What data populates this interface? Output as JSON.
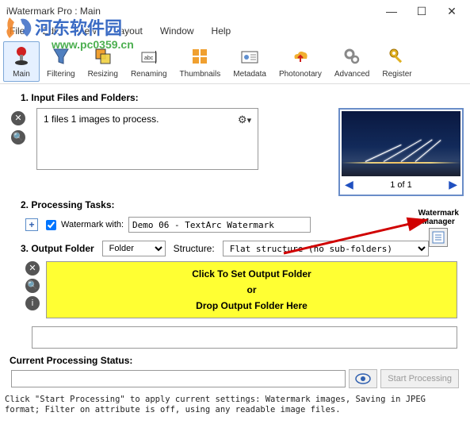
{
  "titlebar": {
    "title": "iWatermark Pro : Main"
  },
  "watermark": {
    "cn": "河东软件园",
    "url": "www.pc0359.cn"
  },
  "menu": {
    "file": "File",
    "edit": "Edit",
    "view": "View",
    "layout": "Layout",
    "window": "Window",
    "help": "Help"
  },
  "toolbar": {
    "main": "Main",
    "filtering": "Filtering",
    "resizing": "Resizing",
    "renaming": "Renaming",
    "thumbnails": "Thumbnails",
    "metadata": "Metadata",
    "photonotary": "Photonotary",
    "advanced": "Advanced",
    "register": "Register"
  },
  "section1": {
    "title": "1. Input Files and Folders:",
    "text": "1 files 1 images to process."
  },
  "preview": {
    "counter": "1  of  1"
  },
  "section2": {
    "title": "2. Processing Tasks:",
    "chk_label": "Watermark with:",
    "wm_value": "Demo 06 - TextArc Watermark",
    "mgr_l1": "Watermark",
    "mgr_l2": "Manager"
  },
  "section3": {
    "title": "3. Output Folder",
    "folder_sel": "Folder",
    "struct_label": "Structure:",
    "struct_sel": "Flat structure (no sub-folders)",
    "out_l1": "Click  To Set Output Folder",
    "out_l2": "or",
    "out_l3": "Drop Output Folder Here"
  },
  "status": {
    "label": "Current Processing Status:",
    "start": "Start Processing"
  },
  "footer": "Click \"Start Processing\" to apply current settings: Watermark images, Saving in JPEG format; Filter on attribute is off, using any readable image files."
}
